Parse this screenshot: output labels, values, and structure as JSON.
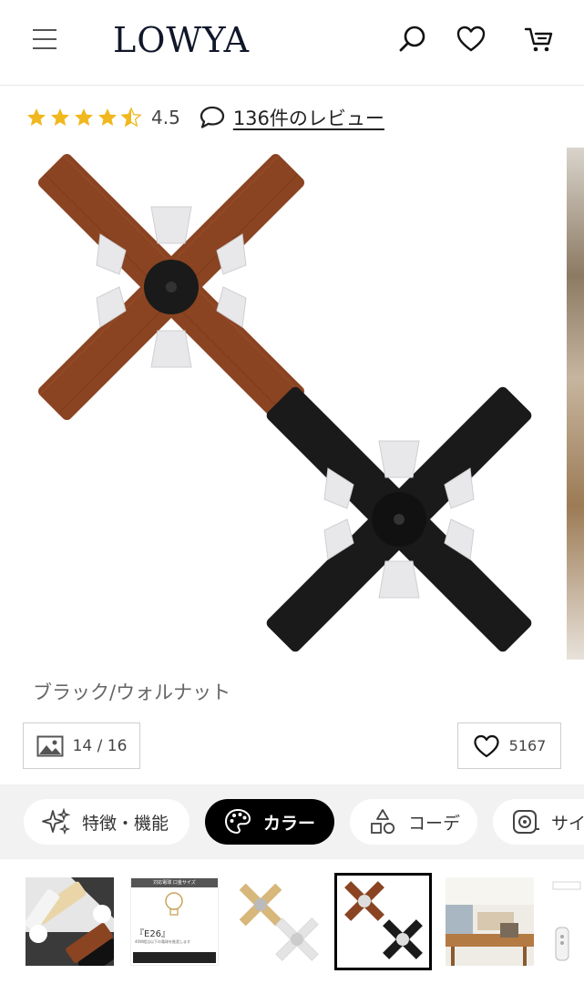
{
  "header": {
    "logo": "LOWYA",
    "menu_icon": "hamburger-menu-icon",
    "search_icon": "search-icon",
    "favorite_icon": "heart-icon",
    "cart_icon": "cart-icon"
  },
  "rating": {
    "stars": 4.5,
    "value": "4.5",
    "review_link": "136件のレビュー",
    "star_color": "#f0b81e"
  },
  "product": {
    "variant_caption": "ブラック/ウォルナット",
    "image_counter": "14 / 16",
    "favorite_count": "5167"
  },
  "tabs": [
    {
      "label": "特徴・機能",
      "icon": "sparkle-icon",
      "active": false
    },
    {
      "label": "カラー",
      "icon": "palette-icon",
      "active": true
    },
    {
      "label": "コーデ",
      "icon": "shapes-icon",
      "active": false
    },
    {
      "label": "サイ",
      "icon": "tape-measure-icon",
      "active": false
    }
  ],
  "thumbnails": {
    "thumb2_title": "対応電球 口金サイズ",
    "thumb2_main": "『E26』",
    "thumb2_sub": "40W相当以下の電球を推奨します",
    "active_index": 3
  },
  "colors": {
    "walnut": "#8a4422",
    "black": "#1a1a1a",
    "shade": "#e8e8ea",
    "text_dark": "#10172a"
  }
}
